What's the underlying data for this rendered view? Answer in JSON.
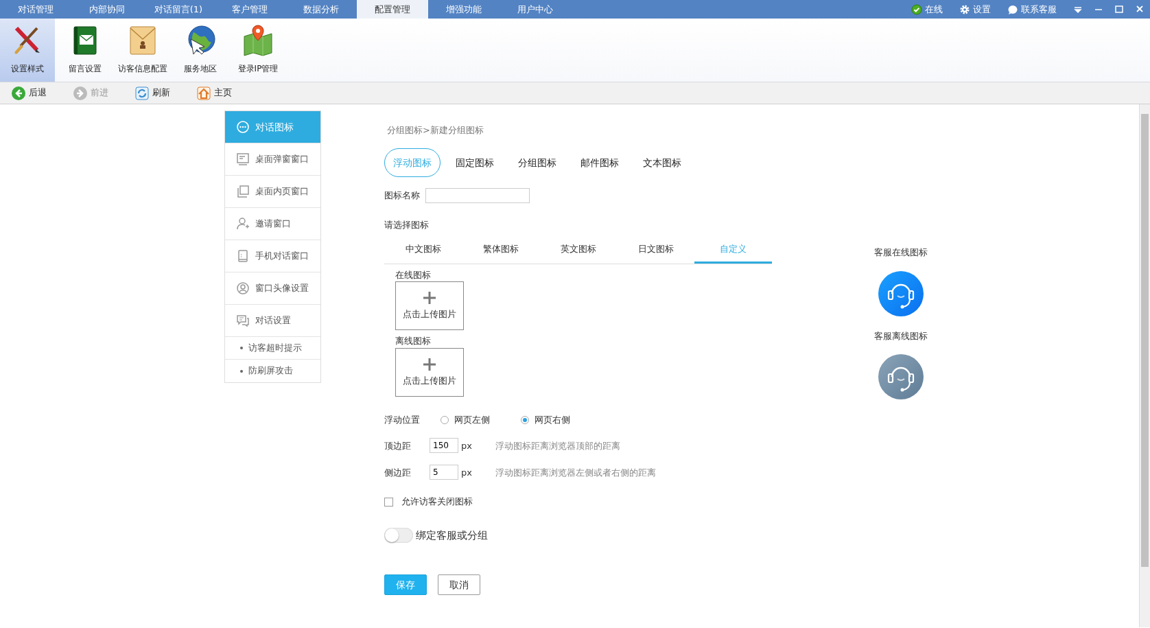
{
  "menu_tabs": [
    {
      "label": "对话管理",
      "selected": false
    },
    {
      "label": "内部协同",
      "selected": false
    },
    {
      "label": "对话留言(1)",
      "selected": false
    },
    {
      "label": "客户管理",
      "selected": false
    },
    {
      "label": "数据分析",
      "selected": false
    },
    {
      "label": "配置管理",
      "selected": true
    },
    {
      "label": "增强功能",
      "selected": false
    },
    {
      "label": "用户中心",
      "selected": false
    }
  ],
  "status_links": [
    {
      "label": "在线",
      "kind": "online"
    },
    {
      "label": "设置",
      "kind": "settings"
    },
    {
      "label": "联系客服",
      "kind": "service"
    }
  ],
  "ribbon": [
    {
      "label": "设置样式",
      "kind": "brush",
      "selected": true
    },
    {
      "label": "留言设置",
      "kind": "book",
      "selected": false
    },
    {
      "label": "访客信息配置",
      "kind": "envelope",
      "selected": false
    },
    {
      "label": "服务地区",
      "kind": "globe",
      "selected": false
    },
    {
      "label": "登录IP管理",
      "kind": "map",
      "selected": false
    }
  ],
  "nav_bar": [
    {
      "label": "后退",
      "kind": "back",
      "disabled": false
    },
    {
      "label": "前进",
      "kind": "forward",
      "disabled": true
    },
    {
      "label": "刷新",
      "kind": "refresh",
      "disabled": false
    },
    {
      "label": "主页",
      "kind": "home",
      "disabled": false
    }
  ],
  "sidebar": {
    "items": [
      {
        "label": "对话图标",
        "kind": "chat",
        "selected": true
      },
      {
        "label": "桌面弹窗窗口",
        "kind": "popup",
        "selected": false
      },
      {
        "label": "桌面内页窗口",
        "kind": "pages",
        "selected": false
      },
      {
        "label": "邀请窗口",
        "kind": "invite",
        "selected": false
      },
      {
        "label": "手机对话窗口",
        "kind": "phone",
        "selected": false
      },
      {
        "label": "窗口头像设置",
        "kind": "avatar",
        "selected": false
      },
      {
        "label": "对话设置",
        "kind": "chats",
        "selected": false
      },
      {
        "label": "访客超时提示",
        "kind": "sub",
        "selected": false
      },
      {
        "label": "防刷屏攻击",
        "kind": "sub",
        "selected": false
      }
    ]
  },
  "breadcrumb": "分组图标>新建分组图标",
  "icon_types": [
    {
      "label": "浮动图标",
      "selected": true
    },
    {
      "label": "固定图标",
      "selected": false
    },
    {
      "label": "分组图标",
      "selected": false
    },
    {
      "label": "邮件图标",
      "selected": false
    },
    {
      "label": "文本图标",
      "selected": false
    }
  ],
  "name_field": {
    "label": "图标名称"
  },
  "choose_label": "请选择图标",
  "icon_tabs": [
    {
      "label": "中文图标",
      "selected": false
    },
    {
      "label": "繁体图标",
      "selected": false
    },
    {
      "label": "英文图标",
      "selected": false
    },
    {
      "label": "日文图标",
      "selected": false
    },
    {
      "label": "自定义",
      "selected": true
    }
  ],
  "uploads": [
    {
      "label": "在线图标",
      "button": "点击上传图片"
    },
    {
      "label": "离线图标",
      "button": "点击上传图片"
    }
  ],
  "position": {
    "label": "浮动位置",
    "options": [
      {
        "label": "网页左侧",
        "selected": false
      },
      {
        "label": "网页右侧",
        "selected": true
      }
    ]
  },
  "margins": [
    {
      "label": "顶边距",
      "value": "150",
      "unit": "px",
      "hint": "浮动图标距离浏览器顶部的距离"
    },
    {
      "label": "侧边距",
      "value": "5",
      "unit": "px",
      "hint": "浮动图标距离浏览器左侧或者右侧的距离"
    }
  ],
  "allow_close": {
    "label": "允许访客关闭图标",
    "checked": false
  },
  "bind": {
    "label": "绑定客服或分组",
    "on": false
  },
  "buttons": [
    {
      "label": "保存",
      "kind": "primary"
    },
    {
      "label": "取消",
      "kind": "secondary"
    }
  ],
  "preview": [
    {
      "label": "客服在线图标",
      "kind": "online"
    },
    {
      "label": "客服离线图标",
      "kind": "offline"
    }
  ]
}
